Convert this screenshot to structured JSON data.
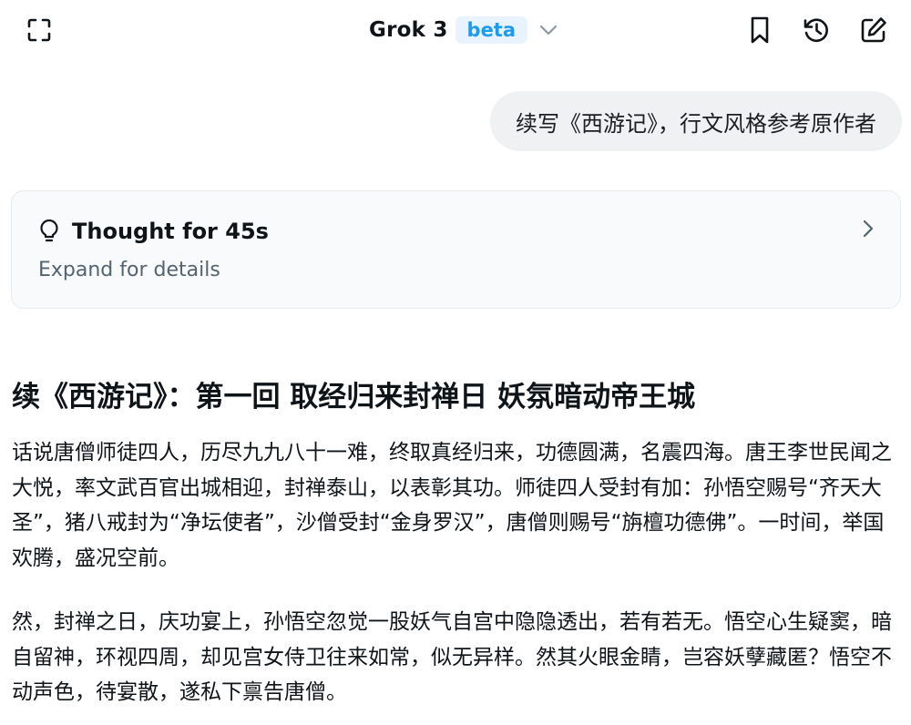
{
  "header": {
    "model_name": "Grok 3",
    "model_badge": "beta",
    "icons": {
      "left": "expand-icon",
      "right": [
        "bookmark-icon",
        "history-icon",
        "new-chat-icon"
      ]
    }
  },
  "conversation": {
    "user_message": "续写《西游记》，行文风格参考原作者",
    "thought": {
      "title": "Thought for 45s",
      "subtitle": "Expand for details"
    },
    "answer": {
      "title": "续《西游记》：第一回 取经归来封禅日 妖氛暗动帝王城",
      "paragraphs": [
        "话说唐僧师徒四人，历尽九九八十一难，终取真经归来，功德圆满，名震四海。唐王李世民闻之大悦，率文武百官出城相迎，封禅泰山，以表彰其功。师徒四人受封有加：孙悟空赐号“齐天大圣”，猪八戒封为“净坛使者”，沙僧受封“金身罗汉”，唐僧则赐号“旃檀功德佛”。一时间，举国欢腾，盛况空前。",
        "然，封禅之日，庆功宴上，孙悟空忽觉一股妖气自宫中隐隐透出，若有若无。悟空心生疑窦，暗自留神，环视四周，却见宫女侍卫往来如常，似无异样。然其火眼金睛，岂容妖孽藏匿？悟空不动声色，待宴散，遂私下禀告唐僧。"
      ]
    }
  },
  "colors": {
    "accent": "#1d9bf0",
    "badge_bg": "#e8f3fd",
    "bubble_bg": "#eff1f3",
    "card_bg": "#f9fafb",
    "muted_text": "#536471"
  }
}
